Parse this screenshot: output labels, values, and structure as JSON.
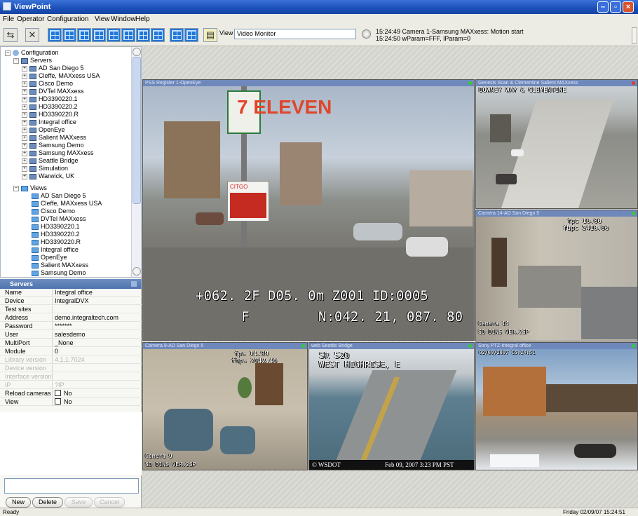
{
  "window": {
    "title": "ViewPoint"
  },
  "menu": [
    "File",
    "Operator",
    "Configuration",
    "View",
    "Window",
    "Help"
  ],
  "toolbar": {
    "view_label": "View",
    "view_value": "Video Monitor",
    "events": [
      "15:24:49 Camera 1-Samsung MAXxess: Motion start",
      "15:24:50 wParam=FFF, lParam=0"
    ]
  },
  "tree": {
    "root": "Configuration",
    "servers_label": "Servers",
    "servers": [
      "AD San Diego 5",
      "Cleffe, MAXxess USA",
      "Cisco Demo",
      "DVTel MAXxess",
      "HD3390220.1",
      "HD3390220.2",
      "HD3390220.R",
      "Integral office",
      "OpenEye",
      "Salient MAXxess",
      "Samsung Demo",
      "Samsung MAXxess",
      "Seattle Bridge",
      "Simulation",
      "Warwick, UK"
    ],
    "views_label": "Views",
    "views": [
      "AD San Diego 5",
      "Cleffe, MAXxess USA",
      "Cisco Demo",
      "DVTel MAXxess",
      "HD3390220.1",
      "HD3390220.2",
      "HD3390220.R",
      "Integral office",
      "OpenEye",
      "Salient MAXxess",
      "Samsung Demo"
    ]
  },
  "properties": {
    "header": "Servers",
    "rows": [
      {
        "k": "Name",
        "v": "Integral office"
      },
      {
        "k": "Device",
        "v": "IntegralDVX"
      },
      {
        "k": "Test sites",
        "v": ""
      },
      {
        "k": "Address",
        "v": "demo.integraltech.com"
      },
      {
        "k": "Password",
        "v": "*******"
      },
      {
        "k": "User",
        "v": "salesdemo"
      },
      {
        "k": "MultiPort",
        "v": "_None"
      },
      {
        "k": "Module",
        "v": "0"
      },
      {
        "k": "Library version",
        "v": "4.1.1.7024",
        "dim": true
      },
      {
        "k": "Device version",
        "v": "",
        "dim": true
      },
      {
        "k": "Interface version",
        "v": "",
        "dim": true
      },
      {
        "k": "IP",
        "v": "?IP",
        "dim": true
      },
      {
        "k": "Reload cameras",
        "v": "No",
        "check": true
      },
      {
        "k": "View",
        "v": "No",
        "check": true
      }
    ]
  },
  "buttons": {
    "new": "New",
    "delete": "Delete",
    "save": "Save",
    "cancel": "Cancel"
  },
  "cameras": {
    "main": {
      "title": "PSS Register 1-OpenEye",
      "sign": "7 ELEVEN",
      "price_sign": "CITGO",
      "osd1": "+062. 2F D05. 0m  Z001 ID:0005",
      "osd2_left": "F",
      "osd2_right": "N:042. 21, 087. 80"
    },
    "top_right": {
      "title": "Genesis Scan & Clementine Salient MAXxess",
      "osd_top": "DOWNEY WAY & CLEMENTINE"
    },
    "mid_right": {
      "title": "Camera 14-AD San Diego 5",
      "fps": "fps 10.00",
      "fbps": "fbps 5410.00",
      "cam": "Camera 14",
      "res": "SD D1NS VER.2SP"
    },
    "bottom_left": {
      "title": "Camera 9-AD San Diego 5",
      "fps": "fps 14.99",
      "fbps": "fbps 2042.46",
      "cam": "Camera 9",
      "res": "SD D1NS VER.2SP"
    },
    "bottom_mid": {
      "title": "web Seattle Bridge",
      "osd1": "SR 520",
      "osd2": "WEST HIGHRISE, E",
      "footer_left": "© WSDOT",
      "footer_right": "Feb 09, 2007  3:23 PM PST"
    },
    "bottom_right": {
      "title": "Sony PTZ-Integral office",
      "stamp": "02/09/2007 15:24:51"
    }
  },
  "status": {
    "left": "Ready",
    "right": "Friday 02/09/07 15:24:51"
  },
  "colors": {
    "titlebar": "#1b4fb8",
    "accent": "#2378d8",
    "cam_title": "#6f88bb"
  }
}
